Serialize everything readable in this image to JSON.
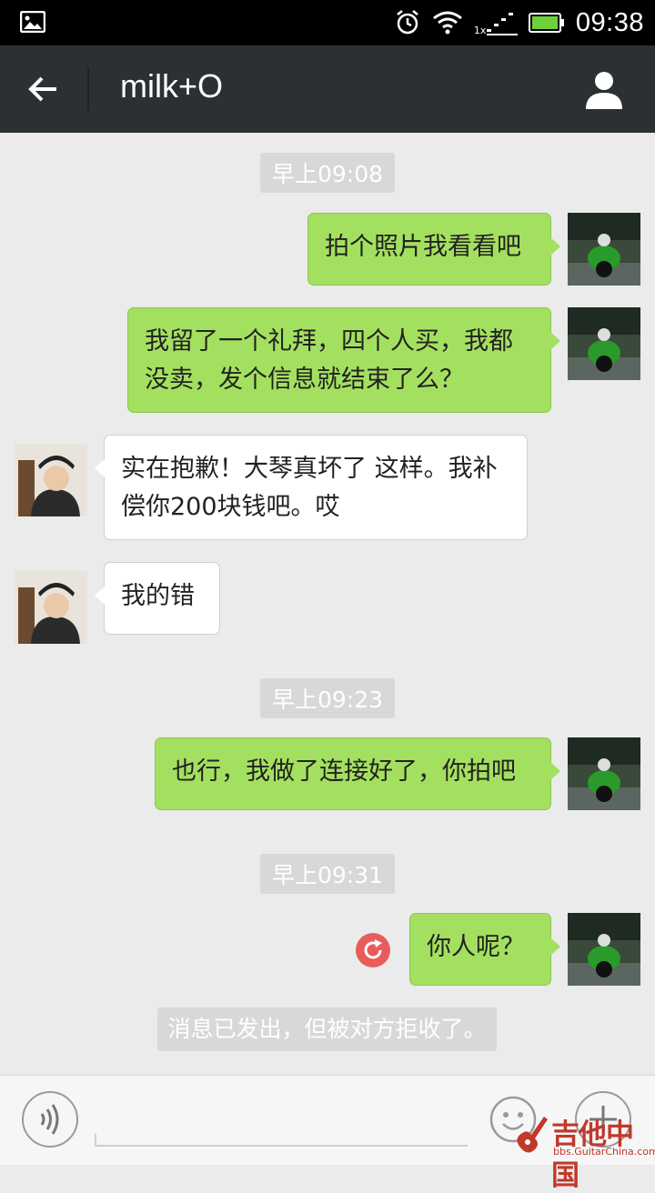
{
  "status_bar": {
    "time": "09:38",
    "network": "1x"
  },
  "header": {
    "title": "milk+O"
  },
  "conversation": [
    {
      "type": "timestamp",
      "text": "早上09:08"
    },
    {
      "type": "message",
      "from": "me",
      "text": "拍个照片我看看吧"
    },
    {
      "type": "message",
      "from": "me",
      "text": "我留了一个礼拜，四个人买，我都没卖，发个信息就结束了么？"
    },
    {
      "type": "message",
      "from": "them",
      "text": "实在抱歉！大琴真坏了 这样。我补偿你200块钱吧。哎"
    },
    {
      "type": "message",
      "from": "them",
      "text": "我的错"
    },
    {
      "type": "timestamp",
      "text": "早上09:23"
    },
    {
      "type": "message",
      "from": "me",
      "text": "也行，我做了连接好了，你拍吧"
    },
    {
      "type": "timestamp",
      "text": "早上09:31"
    },
    {
      "type": "message",
      "from": "me",
      "text": "你人呢？",
      "status": "failed-resend"
    },
    {
      "type": "notice",
      "text": "消息已发出，但被对方拒收了。"
    }
  ],
  "input_bar": {
    "input_value": ""
  },
  "watermark": {
    "text": "吉他中国",
    "sub": "bbs.GuitarChina.com"
  },
  "colors": {
    "my_bubble": "#a4e05f",
    "their_bubble": "#ffffff",
    "header_bg": "#2b3033",
    "chat_bg": "#ebebeb",
    "resend_icon": "#e85c5c"
  }
}
